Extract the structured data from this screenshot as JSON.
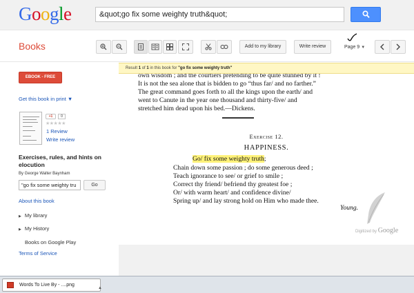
{
  "header": {
    "logo_letters": [
      {
        "ch": "G",
        "color": "#3369e8"
      },
      {
        "ch": "o",
        "color": "#d50f25"
      },
      {
        "ch": "o",
        "color": "#eeb211"
      },
      {
        "ch": "g",
        "color": "#3369e8"
      },
      {
        "ch": "l",
        "color": "#009925"
      },
      {
        "ch": "e",
        "color": "#d50f25"
      }
    ],
    "search_value": "&quot;go fix some weighty truth&quot;"
  },
  "toolbar": {
    "section_title": "Books",
    "add_library_label": "Add to my library",
    "write_review_label": "Write review",
    "page_label": "Page 9"
  },
  "result_bar": {
    "prefix": "Result ",
    "index": "1",
    "of": " of ",
    "total": "1",
    "middle": " in this book for ",
    "query": "\"go fix some weighty truth\""
  },
  "sidebar": {
    "ebook_label": "EBOOK - FREE",
    "get_book_label": "Get this book in print ▼",
    "gplus_label": "+1",
    "gplus_count": "0",
    "stars": "★★★★★",
    "reviews_label": "1 Review",
    "write_review_label": "Write review",
    "book_title": "Exercises, rules, and hints on elocution",
    "author": "By George Walter Baynham",
    "in_book_search_value": "\"go fix some weighty tru",
    "go_label": "Go",
    "about_label": "About this book",
    "menu": [
      {
        "label": "My library"
      },
      {
        "label": "My History"
      }
    ],
    "play_label": "Books on Google Play",
    "tos_label": "Terms of Service"
  },
  "page": {
    "top_lines": [
      "own wisdom ; and the courtiers pretending to be quite stunned by it !",
      "It is not the sea alone that is bidden to go “thus far/ and no farther.”",
      "The great command goes  forth  to all the  kings upon the earth/ and",
      "went  to  Canute  in  the  year  one  thousand  and  thirty-five/ and",
      "stretched him dead upon his bed.—Dickens."
    ],
    "exercise_title": "Exercise 12.",
    "section_title": "HAPPINESS.",
    "highlight_line": "Go/ fix some weighty truth",
    "highlight_after": ";",
    "poem_lines": [
      "Chain down some passion ;  do some generous deed ;",
      "Teach ignorance to see/ or grief to smile ;",
      "Correct thy friend/ befriend thy greatest foe ;",
      "Or/ with warm heart/ and confidence divine/",
      "Spring up/ and lay strong hold on Him who made thee."
    ],
    "signature": "Young.",
    "digitized_prefix": "Digitized by ",
    "digitized_brand": "Google"
  },
  "taskbar": {
    "item_label": "Words To Live By - ....png"
  }
}
